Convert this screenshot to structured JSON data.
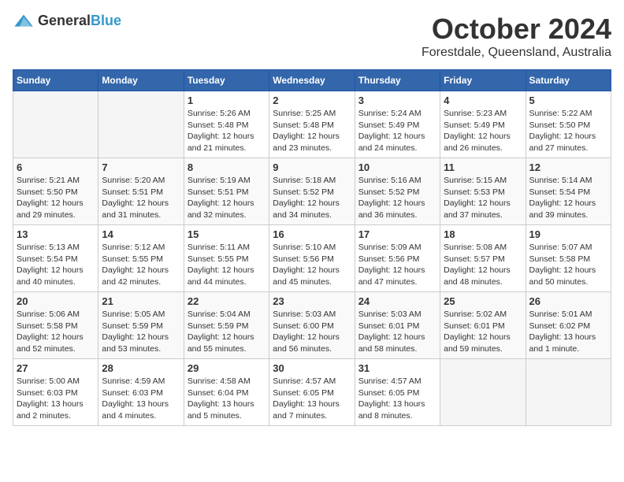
{
  "header": {
    "logo": {
      "general": "General",
      "blue": "Blue"
    },
    "title": "October 2024",
    "location": "Forestdale, Queensland, Australia"
  },
  "weekdays": [
    "Sunday",
    "Monday",
    "Tuesday",
    "Wednesday",
    "Thursday",
    "Friday",
    "Saturday"
  ],
  "weeks": [
    [
      {
        "day": "",
        "info": ""
      },
      {
        "day": "",
        "info": ""
      },
      {
        "day": "1",
        "info": "Sunrise: 5:26 AM\nSunset: 5:48 PM\nDaylight: 12 hours and 21 minutes."
      },
      {
        "day": "2",
        "info": "Sunrise: 5:25 AM\nSunset: 5:48 PM\nDaylight: 12 hours and 23 minutes."
      },
      {
        "day": "3",
        "info": "Sunrise: 5:24 AM\nSunset: 5:49 PM\nDaylight: 12 hours and 24 minutes."
      },
      {
        "day": "4",
        "info": "Sunrise: 5:23 AM\nSunset: 5:49 PM\nDaylight: 12 hours and 26 minutes."
      },
      {
        "day": "5",
        "info": "Sunrise: 5:22 AM\nSunset: 5:50 PM\nDaylight: 12 hours and 27 minutes."
      }
    ],
    [
      {
        "day": "6",
        "info": "Sunrise: 5:21 AM\nSunset: 5:50 PM\nDaylight: 12 hours and 29 minutes."
      },
      {
        "day": "7",
        "info": "Sunrise: 5:20 AM\nSunset: 5:51 PM\nDaylight: 12 hours and 31 minutes."
      },
      {
        "day": "8",
        "info": "Sunrise: 5:19 AM\nSunset: 5:51 PM\nDaylight: 12 hours and 32 minutes."
      },
      {
        "day": "9",
        "info": "Sunrise: 5:18 AM\nSunset: 5:52 PM\nDaylight: 12 hours and 34 minutes."
      },
      {
        "day": "10",
        "info": "Sunrise: 5:16 AM\nSunset: 5:52 PM\nDaylight: 12 hours and 36 minutes."
      },
      {
        "day": "11",
        "info": "Sunrise: 5:15 AM\nSunset: 5:53 PM\nDaylight: 12 hours and 37 minutes."
      },
      {
        "day": "12",
        "info": "Sunrise: 5:14 AM\nSunset: 5:54 PM\nDaylight: 12 hours and 39 minutes."
      }
    ],
    [
      {
        "day": "13",
        "info": "Sunrise: 5:13 AM\nSunset: 5:54 PM\nDaylight: 12 hours and 40 minutes."
      },
      {
        "day": "14",
        "info": "Sunrise: 5:12 AM\nSunset: 5:55 PM\nDaylight: 12 hours and 42 minutes."
      },
      {
        "day": "15",
        "info": "Sunrise: 5:11 AM\nSunset: 5:55 PM\nDaylight: 12 hours and 44 minutes."
      },
      {
        "day": "16",
        "info": "Sunrise: 5:10 AM\nSunset: 5:56 PM\nDaylight: 12 hours and 45 minutes."
      },
      {
        "day": "17",
        "info": "Sunrise: 5:09 AM\nSunset: 5:56 PM\nDaylight: 12 hours and 47 minutes."
      },
      {
        "day": "18",
        "info": "Sunrise: 5:08 AM\nSunset: 5:57 PM\nDaylight: 12 hours and 48 minutes."
      },
      {
        "day": "19",
        "info": "Sunrise: 5:07 AM\nSunset: 5:58 PM\nDaylight: 12 hours and 50 minutes."
      }
    ],
    [
      {
        "day": "20",
        "info": "Sunrise: 5:06 AM\nSunset: 5:58 PM\nDaylight: 12 hours and 52 minutes."
      },
      {
        "day": "21",
        "info": "Sunrise: 5:05 AM\nSunset: 5:59 PM\nDaylight: 12 hours and 53 minutes."
      },
      {
        "day": "22",
        "info": "Sunrise: 5:04 AM\nSunset: 5:59 PM\nDaylight: 12 hours and 55 minutes."
      },
      {
        "day": "23",
        "info": "Sunrise: 5:03 AM\nSunset: 6:00 PM\nDaylight: 12 hours and 56 minutes."
      },
      {
        "day": "24",
        "info": "Sunrise: 5:03 AM\nSunset: 6:01 PM\nDaylight: 12 hours and 58 minutes."
      },
      {
        "day": "25",
        "info": "Sunrise: 5:02 AM\nSunset: 6:01 PM\nDaylight: 12 hours and 59 minutes."
      },
      {
        "day": "26",
        "info": "Sunrise: 5:01 AM\nSunset: 6:02 PM\nDaylight: 13 hours and 1 minute."
      }
    ],
    [
      {
        "day": "27",
        "info": "Sunrise: 5:00 AM\nSunset: 6:03 PM\nDaylight: 13 hours and 2 minutes."
      },
      {
        "day": "28",
        "info": "Sunrise: 4:59 AM\nSunset: 6:03 PM\nDaylight: 13 hours and 4 minutes."
      },
      {
        "day": "29",
        "info": "Sunrise: 4:58 AM\nSunset: 6:04 PM\nDaylight: 13 hours and 5 minutes."
      },
      {
        "day": "30",
        "info": "Sunrise: 4:57 AM\nSunset: 6:05 PM\nDaylight: 13 hours and 7 minutes."
      },
      {
        "day": "31",
        "info": "Sunrise: 4:57 AM\nSunset: 6:05 PM\nDaylight: 13 hours and 8 minutes."
      },
      {
        "day": "",
        "info": ""
      },
      {
        "day": "",
        "info": ""
      }
    ]
  ]
}
